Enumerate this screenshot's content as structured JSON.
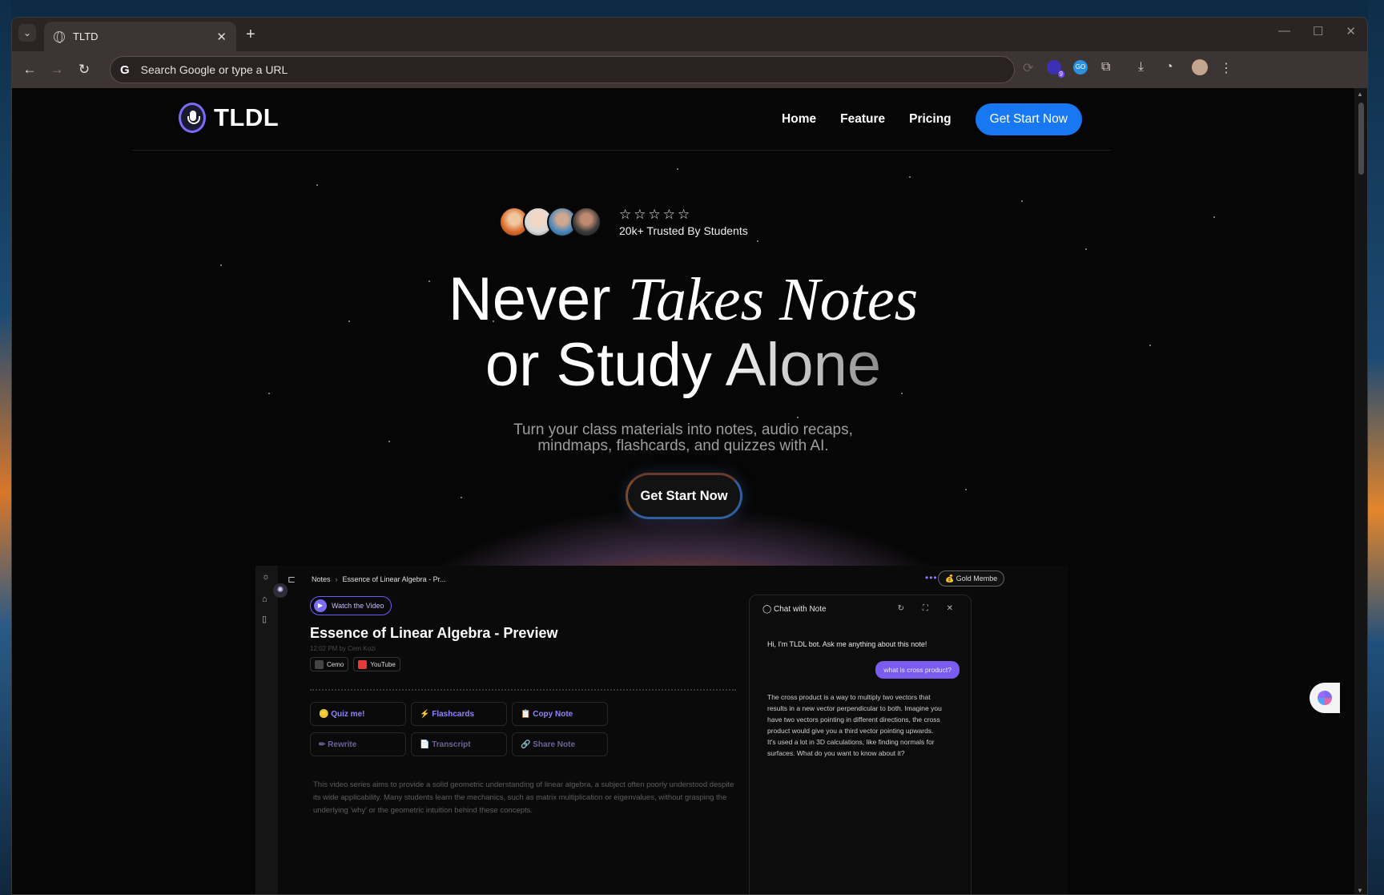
{
  "browser": {
    "tab_title": "TLTD",
    "tab_close": "✕",
    "new_tab": "+",
    "menu_glyph": "⌄",
    "window_controls": [
      "—",
      "☐",
      "✕"
    ],
    "back": "←",
    "forward": "→",
    "reload": "↻",
    "omnibox_g": "G",
    "omnibox_placeholder": "Search Google or type a URL",
    "extension_badge": "9",
    "icons": [
      "ask-icon",
      "extension-9-icon",
      "extension-cloud-icon",
      "puzzle-icon",
      "download-icon",
      "music-icon",
      "profile-avatar-icon",
      "kebab-menu-icon"
    ]
  },
  "site": {
    "brand": "TLDL",
    "nav": {
      "home": "Home",
      "feature": "Feature",
      "pricing": "Pricing",
      "cta": "Get Start Now"
    }
  },
  "hero": {
    "rating_stars": "☆☆☆☆☆",
    "trusted": "20k+ Trusted By Students",
    "headline_1a": "Never",
    "headline_1b": "Takes Notes",
    "headline_2a": "or Study",
    "headline_2b": "Alone",
    "subtitle_1": "Turn your class materials into notes, audio recaps,",
    "subtitle_2": "mindmaps, flashcards, and quizzes with AI.",
    "cta": "Get Start Now"
  },
  "preview": {
    "breadcrumb_root": "Notes",
    "breadcrumb_sep": "›",
    "breadcrumb_current": "Essence of Linear Algebra - Pr...",
    "more": "•••",
    "membership": "💰 Gold Membe",
    "watch": "Watch the Video",
    "note_title": "Essence of Linear Algebra - Preview",
    "note_meta": "12:02 PM by Cem Kozi",
    "tag_1": "Cemo",
    "tag_2": "YouTube",
    "actions": [
      "🪙 Quiz me!",
      "⚡ Flashcards",
      "📋 Copy Note",
      "✏ Rewrite",
      "📄 Transcript",
      "🔗 Share Note"
    ],
    "body": "This video series aims to provide a solid geometric understanding of linear algebra, a subject often poorly understood despite its wide applicability. Many students learn the mechanics, such as matrix multiplication or eigenvalues, without grasping the underlying 'why' or the geometric intuition behind these concepts.",
    "chat": {
      "title": "Chat with Note",
      "icons": "↻ ⛶ ✕",
      "bot_greeting": "Hi, I'm TLDL bot. Ask me anything about this note!",
      "user_msg": "what is cross product?",
      "bot_answer": "The cross product is a way to multiply two vectors that results in a new vector perpendicular to both. Imagine you have two vectors pointing in different directions, the cross product would give you a third vector pointing upwards. It's used a lot in 3D calculations, like finding normals for surfaces. What do you want to know about it?"
    }
  },
  "colors": {
    "accent": "#1877f2",
    "purple": "#7b6cf6"
  }
}
